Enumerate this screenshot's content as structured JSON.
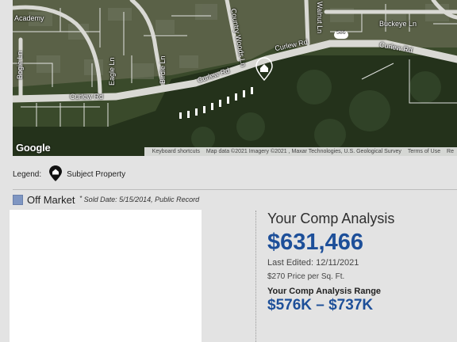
{
  "map": {
    "streets": {
      "academy": "Academy",
      "country_woods": "Country Woods Ln",
      "walnut": "Walnut Ln",
      "buckeye": "Buckeye Ln",
      "curlew_top": "Curlew Rd",
      "curlew_right": "Curlew Rd",
      "curlew_mid": "Curlew Rd",
      "curlew_left": "Curlew Rd",
      "bogie": "Bogie Ln",
      "eagle": "Eagle Ln",
      "birdie": "Birdie Ln",
      "route_shield": "586"
    },
    "google_logo": "Google",
    "attribution": {
      "shortcuts": "Keyboard shortcuts",
      "data": "Map data ©2021 Imagery ©2021 , Maxar Technologies, U.S. Geological Survey",
      "terms": "Terms of Use",
      "report": "Re"
    }
  },
  "legend": {
    "label": "Legend:",
    "item": "Subject Property"
  },
  "status": {
    "label": "Off Market",
    "marker": "*",
    "note": "Sold Date: 5/15/2014, Public Record",
    "color": "#7f96c2"
  },
  "analysis": {
    "title": "Your Comp Analysis",
    "value": "$631,466",
    "last_edited": "Last Edited: 12/11/2021",
    "price_per_sqft": "$270 Price per Sq. Ft.",
    "range_label": "Your Comp Analysis Range",
    "range": "$576K – $737K",
    "accent_color": "#1d4f99"
  }
}
